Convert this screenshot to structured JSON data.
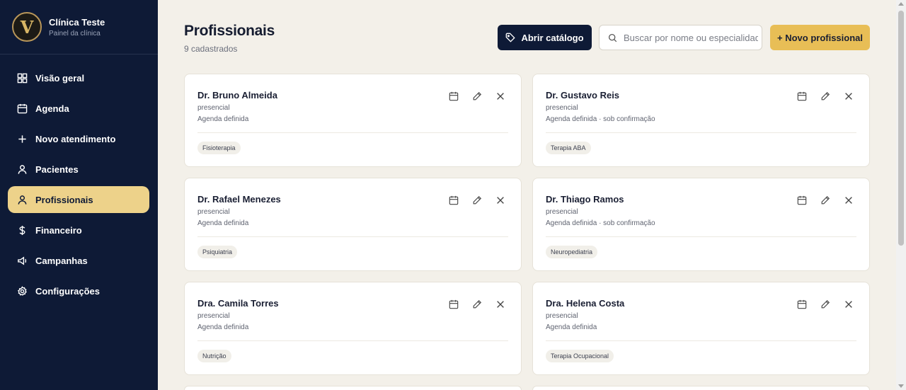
{
  "brand": {
    "logo_letter": "V",
    "name": "Clínica Teste",
    "subtitle": "Painel da clínica"
  },
  "sidebar": {
    "items": [
      {
        "label": "Visão geral",
        "icon": "dashboard-icon",
        "active": false
      },
      {
        "label": "Agenda",
        "icon": "calendar-icon",
        "active": false
      },
      {
        "label": "Novo atendimento",
        "icon": "plus-icon",
        "active": false
      },
      {
        "label": "Pacientes",
        "icon": "user-icon",
        "active": false
      },
      {
        "label": "Profissionais",
        "icon": "user-icon",
        "active": true
      },
      {
        "label": "Financeiro",
        "icon": "dollar-icon",
        "active": false
      },
      {
        "label": "Campanhas",
        "icon": "megaphone-icon",
        "active": false
      },
      {
        "label": "Configurações",
        "icon": "gear-icon",
        "active": false
      }
    ]
  },
  "header": {
    "title": "Profissionais",
    "count_text": "9 cadastrados",
    "catalog_label": "Abrir catálogo",
    "search_placeholder": "Buscar por nome ou especialidade",
    "new_label": "+ Novo profissional"
  },
  "professionals": [
    {
      "name": "Dr. Bruno Almeida",
      "mode": "presencial",
      "status": "Agenda definida",
      "specialty": "Fisioterapia"
    },
    {
      "name": "Dr. Gustavo Reis",
      "mode": "presencial",
      "status": "Agenda definida · sob confirmação",
      "specialty": "Terapia ABA"
    },
    {
      "name": "Dr. Rafael Menezes",
      "mode": "presencial",
      "status": "Agenda definida",
      "specialty": "Psiquiatria"
    },
    {
      "name": "Dr. Thiago Ramos",
      "mode": "presencial",
      "status": "Agenda definida · sob confirmação",
      "specialty": "Neuropediatria"
    },
    {
      "name": "Dra. Camila Torres",
      "mode": "presencial",
      "status": "Agenda definida",
      "specialty": "Nutrição"
    },
    {
      "name": "Dra. Helena Costa",
      "mode": "presencial",
      "status": "Agenda definida",
      "specialty": "Terapia Ocupacional"
    }
  ],
  "colors": {
    "sidebar_bg": "#0e1a36",
    "active_item": "#edd28a",
    "accent": "#e8be56",
    "page_bg": "#f3f0e9"
  }
}
